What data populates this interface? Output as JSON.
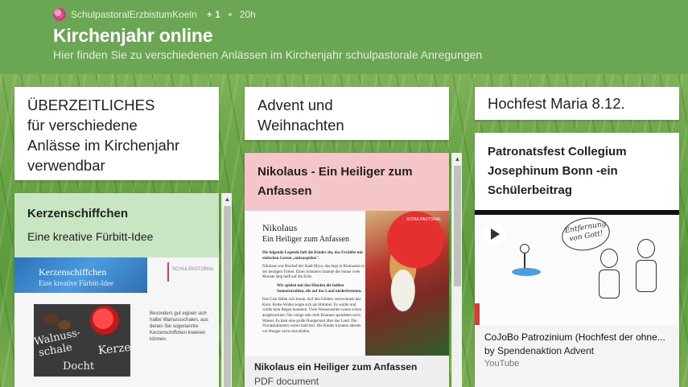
{
  "header": {
    "author": "SchulpastoralErzbistumKoeln",
    "plus": "+ 1",
    "time": "20h",
    "title": "Kirchenjahr online",
    "subtitle": "Hier finden Sie zu verschiedenen Anlässen im Kirchenjahr schulpastorale Anregungen"
  },
  "columns": [
    {
      "heading_lines": [
        "ÜBERZEITLICHES",
        "für verschiedene",
        "Anlässe im Kirchenjahr",
        "verwendbar"
      ],
      "card": {
        "title": "Kerzenschiffchen",
        "subtitle": "Eine kreative Fürbitt-Idee",
        "thumb_title": "Kerzenschiffchen",
        "thumb_subtitle": "Eine kreative Fürbitt-Idee",
        "logo": "SCHULPASTORAL",
        "body_text": "Besonders gut eignen sich halbe Walnussschalen, aus denen Sie sogenannte Kerzenschiffchen kreieren können.",
        "chalk_1": "Walnuss-",
        "chalk_2": "schale",
        "chalk_3": "Kerze",
        "chalk_4": "Docht",
        "bg_color": "#c9e6c2"
      }
    },
    {
      "heading_lines": [
        "Advent und",
        "Weihnachten"
      ],
      "card": {
        "title_lines": [
          "Nikolaus - Ein Heiliger zum",
          "Anfassen"
        ],
        "doc_title": "Nikolaus",
        "doc_subtitle": "Ein Heiliger zum Anfassen",
        "doc_paragraphs": [
          "Die folgende Legende lädt die Kinder ein, das Erzählte mit einfachen Gesten „mitzuspielen\".",
          "Nikolaus war Bischof der Stadt Myra, das liegt in Kleinasien in der heutigen Türkei. Eines Sommers brannte die Sonne viele Monate lang heiß auf die Erde.",
          "Wir spielen mit den Händen die heißen Sonnenstrahlen, die auf das Land niederbrennen.",
          "Das Gras färbte sich braun. Auf den Feldern vertrocknete das Korn. Keine Wolke zeigte sich am Himmel. Es wollte und wollte kein Regen kommen. Viele Wasserstellen waren schon ausgetrocknet. Nur einige sehr tiefe Brunnen spendeten noch Wasser. Es kam eine große Hungersnot über das Land. Die Vorratskammern waren bald leer. Die Kinder konnten abends vor Hunger nicht einschlafen."
        ],
        "logo": "SCHULPASTORAL",
        "attachment_title": "Nikolaus ein Heiliger zum Anfassen",
        "attachment_type": "PDF document",
        "bg_color": "#f4c6c9"
      }
    },
    {
      "heading_lines": [
        "Hochfest Maria 8.12."
      ],
      "card": {
        "title_lines": [
          "Patronatsfest Collegium",
          "Josephinum Bonn -ein",
          "Schülerbeitrag"
        ],
        "video_handwriting": "Entfernung von Gott!",
        "link_title": "CoJoBo Patrozinium (Hochfest der ohne...",
        "link_by": "by Spendenaktion Advent",
        "link_source": "YouTube"
      }
    }
  ]
}
